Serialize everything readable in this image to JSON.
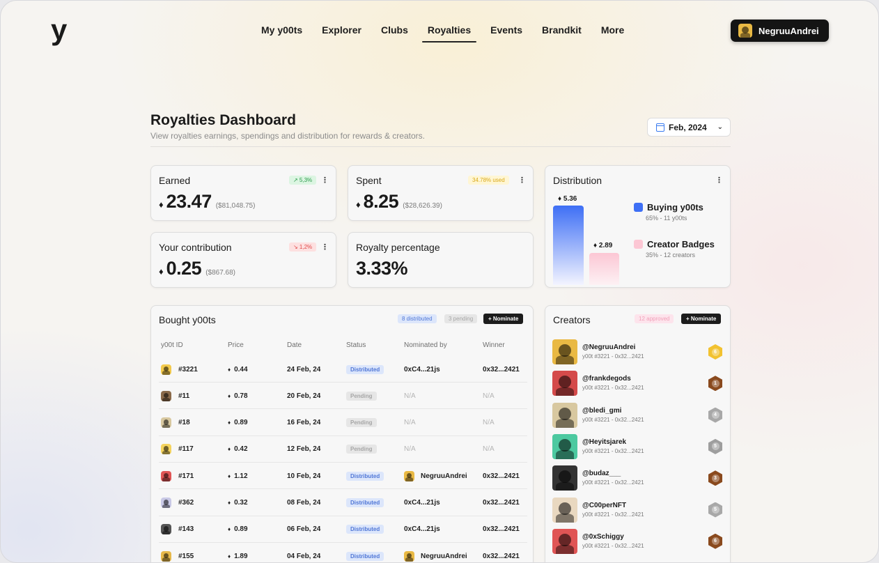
{
  "app": {
    "logo": "y",
    "nav": [
      "My y00ts",
      "Explorer",
      "Clubs",
      "Royalties",
      "Events",
      "Brandkit",
      "More"
    ],
    "active_nav": "Royalties",
    "user": {
      "name": "NegruuAndrei",
      "avatar_color": "#e9b944"
    }
  },
  "header": {
    "title": "Royalties Dashboard",
    "subtitle": "View royalties earnings, spendings and distribution for rewards & creators.",
    "date": "Feb, 2024"
  },
  "earned": {
    "title": "Earned",
    "badge": "↗ 5,3%",
    "value": "23.47",
    "usd": "($81,048.75)"
  },
  "spent": {
    "title": "Spent",
    "badge": "34.78% used",
    "value": "8.25",
    "usd": "($28,626.39)"
  },
  "contribution": {
    "title": "Your contribution",
    "badge": "↘ 1,2%",
    "value": "0.25",
    "usd": "($867.68)"
  },
  "royalty": {
    "title": "Royalty percentage",
    "value": "3.33%"
  },
  "distribution": {
    "title": "Distribution",
    "bar1_value": "♦ 5.36",
    "bar2_value": "♦ 2.89",
    "legend1_title": "Buying y00ts",
    "legend1_sub": "65% - 11 y00ts",
    "legend2_title": "Creator Badges",
    "legend2_sub": "35% - 12 creators",
    "colors": {
      "buying": "#3e6ff5",
      "badges": "#fcc7d4"
    }
  },
  "bought": {
    "title": "Bought y00ts",
    "distributed_badge": "8 distributed",
    "pending_badge": "3 pending",
    "nominate": "+ Nominate",
    "columns": [
      "y00t ID",
      "Price",
      "Date",
      "Status",
      "Nominated by",
      "Winner"
    ],
    "rows": [
      {
        "id": "#3221",
        "price": "0.44",
        "date": "24 Feb, 24",
        "status": "Distributed",
        "nominated": "0xC4...21js",
        "winner": "0x32...2421",
        "color": "#f2c94c"
      },
      {
        "id": "#11",
        "price": "0.78",
        "date": "20 Feb, 24",
        "status": "Pending",
        "nominated": "N/A",
        "winner": "N/A",
        "color": "#8a6a4a"
      },
      {
        "id": "#18",
        "price": "0.89",
        "date": "16 Feb, 24",
        "status": "Pending",
        "nominated": "N/A",
        "winner": "N/A",
        "color": "#d8c8a0"
      },
      {
        "id": "#117",
        "price": "0.42",
        "date": "12 Feb, 24",
        "status": "Pending",
        "nominated": "N/A",
        "winner": "N/A",
        "color": "#f4d35e"
      },
      {
        "id": "#171",
        "price": "1.12",
        "date": "10 Feb, 24",
        "status": "Distributed",
        "nominated": "NegruuAndrei",
        "winner": "0x32...2421",
        "color": "#e05555"
      },
      {
        "id": "#362",
        "price": "0.32",
        "date": "08 Feb, 24",
        "status": "Distributed",
        "nominated": "0xC4...21js",
        "winner": "0x32...2421",
        "color": "#c9c9e6"
      },
      {
        "id": "#143",
        "price": "0.89",
        "date": "06 Feb, 24",
        "status": "Distributed",
        "nominated": "0xC4...21js",
        "winner": "0x32...2421",
        "color": "#555555"
      },
      {
        "id": "#155",
        "price": "1.89",
        "date": "04 Feb, 24",
        "status": "Distributed",
        "nominated": "NegruuAndrei",
        "winner": "0x32...2421",
        "color": "#e6b84a"
      }
    ]
  },
  "creators": {
    "title": "Creators",
    "approved_badge": "12 approved",
    "nominate": "+ Nominate",
    "rows": [
      {
        "name": "@NegruuAndrei",
        "sub": "y00t #3221 - 0x32...2421",
        "badge": "#f2c230",
        "badge_label": "6",
        "color": "#e9b944"
      },
      {
        "name": "@frankdegods",
        "sub": "y00t #3221 - 0x32...2421",
        "badge": "#8a4a1e",
        "badge_label": "1",
        "color": "#d44a4a"
      },
      {
        "name": "@bledi_gmi",
        "sub": "y00t #3221 - 0x32...2421",
        "badge": "#a8a8a8",
        "badge_label": "4",
        "color": "#d8c8a0"
      },
      {
        "name": "@Heyitsjarek",
        "sub": "y00t #3221 - 0x32...2421",
        "badge": "#9e9e9e",
        "badge_label": "5",
        "color": "#4cc9a0"
      },
      {
        "name": "@budaz___",
        "sub": "y00t #3221 - 0x32...2421",
        "badge": "#8a4a1e",
        "badge_label": "3",
        "color": "#333333"
      },
      {
        "name": "@C00perNFT",
        "sub": "y00t #3221 - 0x32...2421",
        "badge": "#a8a8a8",
        "badge_label": "5",
        "color": "#e9d8c0"
      },
      {
        "name": "@0xSchiggy",
        "sub": "y00t #3221 - 0x32...2421",
        "badge": "#8a4a1e",
        "badge_label": "6",
        "color": "#e05555"
      }
    ]
  }
}
